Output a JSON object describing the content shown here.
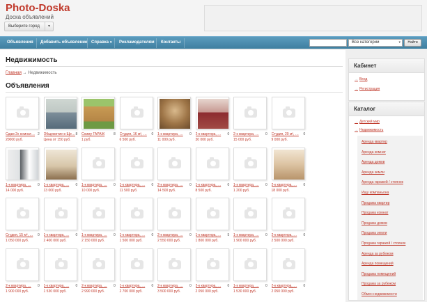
{
  "header": {
    "logo": "Photo-Doska",
    "slogan": "Доска объявлений",
    "city_select": "Выберите город"
  },
  "nav": {
    "items": [
      "Объявления",
      "Добавить объявление",
      "Справка »",
      "Рекламодателям",
      "Контакты"
    ],
    "search_placeholder": "",
    "category_select": "Все категории",
    "find_button": "Найти"
  },
  "main": {
    "page_title": "Недвижимость",
    "breadcrumb_home": "Главная",
    "breadcrumb_arrow": "→",
    "breadcrumb_current": "Недвижимость",
    "section_title": "Объявления"
  },
  "listings": [
    {
      "title": "Сдам 2х комнат…",
      "price": "20000 руб.",
      "count": "2",
      "photo": "none"
    },
    {
      "title": "Общежитие в Ще…",
      "price": "Цена от 150 руб.",
      "count": "8",
      "photo": "dorm"
    },
    {
      "title": "Сниму ГАРАЖ",
      "price": "1 руб.",
      "count": "8",
      "photo": "garage"
    },
    {
      "title": "Студия, 16 м², …",
      "price": "6 500 руб.",
      "count": "0",
      "photo": "none"
    },
    {
      "title": "1-к квартира, …",
      "price": "11 000 руб.",
      "count": "0",
      "photo": "room-brown"
    },
    {
      "title": "2-к квартира, …",
      "price": "30 000 руб.",
      "count": "0",
      "photo": "room-red"
    },
    {
      "title": "2-к квартира, …",
      "price": "15 000 руб.",
      "count": "0",
      "photo": "none"
    },
    {
      "title": "Студия, 20 м², …",
      "price": "9 000 руб.",
      "count": "0",
      "photo": "none"
    },
    {
      "title": "1-к квартира, …",
      "price": "14 000 руб.",
      "count": "0",
      "photo": "kitchen"
    },
    {
      "title": "1-к квартира, …",
      "price": "13 000 руб.",
      "count": "0",
      "photo": "room-beige"
    },
    {
      "title": "1-к квартира, …",
      "price": "10 000 руб.",
      "count": "0",
      "photo": "none"
    },
    {
      "title": "1-к квартира, …",
      "price": "11 500 руб.",
      "count": "0",
      "photo": "none"
    },
    {
      "title": "2-к квартира, …",
      "price": "14 500 руб.",
      "count": "0",
      "photo": "none"
    },
    {
      "title": "1-к квартира, …",
      "price": "8 500 руб.",
      "count": "0",
      "photo": "none"
    },
    {
      "title": "1-к квартира, …",
      "price": "1 200 руб.",
      "count": "0",
      "photo": "none"
    },
    {
      "title": "2-к квартира, …",
      "price": "18 000 руб.",
      "count": "0",
      "photo": "room-hall"
    },
    {
      "title": "Студия, 15 м², …",
      "price": "1 050 000 руб.",
      "count": "0",
      "photo": "none"
    },
    {
      "title": "1-к квартира, …",
      "price": "2 400 000 руб.",
      "count": "0",
      "photo": "none"
    },
    {
      "title": "1-к квартира, …",
      "price": "2 150 000 руб.",
      "count": "0",
      "photo": "none"
    },
    {
      "title": "1-к квартира, …",
      "price": "1 500 000 руб.",
      "count": "0",
      "photo": "none"
    },
    {
      "title": "2-к квартира, …",
      "price": "2 550 000 руб.",
      "count": "0",
      "photo": "none"
    },
    {
      "title": "1-к квартира, …",
      "price": "1 800 000 руб.",
      "count": "5",
      "photo": "none"
    },
    {
      "title": "1-к квартира, …",
      "price": "1 900 000 руб.",
      "count": "0",
      "photo": "none"
    },
    {
      "title": "2-к квартира, …",
      "price": "2 500 000 руб.",
      "count": "0",
      "photo": "none"
    },
    {
      "title": "2-к квартира, …",
      "price": "1 900 000 руб.",
      "count": "0",
      "photo": "none"
    },
    {
      "title": "1-к квартира, …",
      "price": "1 530 000 руб.",
      "count": "0",
      "photo": "none"
    },
    {
      "title": "2-к квартира, …",
      "price": "2 990 000 руб.",
      "count": "0",
      "photo": "none"
    },
    {
      "title": "1-к квартира, …",
      "price": "2 700 000 руб.",
      "count": "0",
      "photo": "none"
    },
    {
      "title": "2-к квартира, …",
      "price": "3 500 000 руб.",
      "count": "0",
      "photo": "none"
    },
    {
      "title": "2-к квартира, …",
      "price": "2 050 000 руб.",
      "count": "0",
      "photo": "none"
    },
    {
      "title": "1-к квартира, …",
      "price": "1 530 000 руб.",
      "count": "0",
      "photo": "none"
    },
    {
      "title": "2-к квартира, …",
      "price": "2 050 000 руб.",
      "count": "0",
      "photo": "none"
    }
  ],
  "sidebar": {
    "cabinet_title": "Кабинет",
    "cabinet_links": [
      "Вход",
      "Регистрация"
    ],
    "catalog_title": "Каталог",
    "catalog_links": [
      "Детский мир",
      "Недвижимость"
    ],
    "realty_items": [
      "Аренда квартир",
      "Аренда комнат",
      "Аренда домов",
      "Аренда земли",
      "Аренда гаражей / стоянок",
      "Ищу компаньона",
      "Продажа квартир",
      "Продажа комнат",
      "Продажа домов",
      "Продажа земли",
      "Продажа гаражей / стоянок",
      "Аренда за рубежом",
      "Аренда помещений",
      "Продажа помещений",
      "Продажа за рубежом",
      "Обмен недвижимости"
    ]
  },
  "colors": {
    "brand": "#c0392b",
    "nav": "#4a8bb0"
  }
}
